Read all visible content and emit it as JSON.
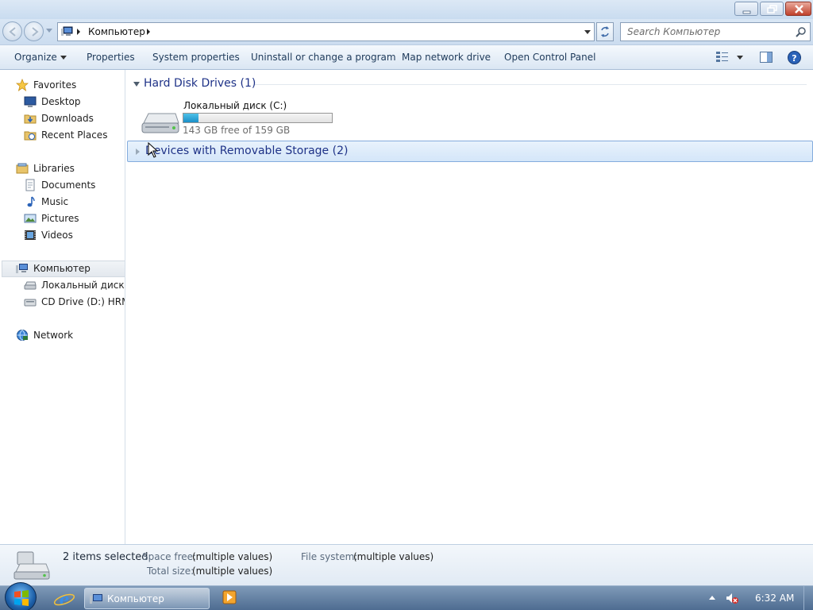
{
  "window": {
    "address_path": "Компьютер",
    "search_placeholder": "Search Компьютер"
  },
  "commands": {
    "organize": "Organize",
    "properties": "Properties",
    "system_properties": "System properties",
    "uninstall": "Uninstall or change a program",
    "map_drive": "Map network drive",
    "control_panel": "Open Control Panel"
  },
  "sidebar": {
    "favorites": "Favorites",
    "desktop": "Desktop",
    "downloads": "Downloads",
    "recent": "Recent Places",
    "libraries": "Libraries",
    "documents": "Documents",
    "music": "Music",
    "pictures": "Pictures",
    "videos": "Videos",
    "computer": "Компьютер",
    "local_disk": "Локальный диск (C",
    "cd_drive": "CD Drive (D:) HRM_(",
    "network": "Network"
  },
  "content": {
    "group_hdd": "Hard Disk Drives (1)",
    "group_removable": "Devices with Removable Storage (2)",
    "drive_name": "Локальный диск (C:)",
    "drive_free_text": "143 GB free of 159 GB",
    "drive_used_fraction": 0.1
  },
  "details": {
    "count": "2 items selected",
    "space_free_label": "Space free:",
    "space_free_value": "(multiple values)",
    "total_size_label": "Total size:",
    "total_size_value": "(multiple values)",
    "fs_label": "File system:",
    "fs_value": "(multiple values)"
  },
  "taskbar": {
    "window_button": "Компьютер",
    "clock": "6:32 AM"
  }
}
